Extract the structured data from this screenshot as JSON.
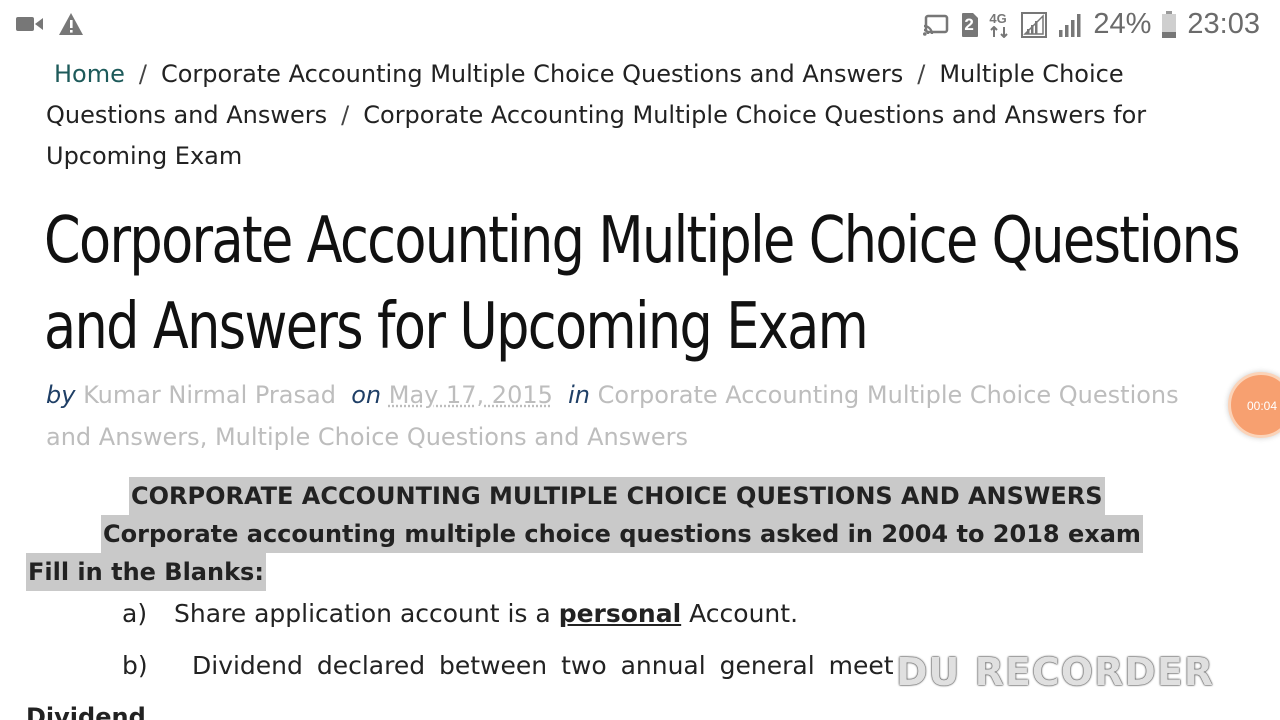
{
  "status_bar": {
    "battery": "24%",
    "time": "23:03",
    "sim_badge": "2",
    "network": "4G",
    "icons": [
      "video-camera-icon",
      "warning-icon",
      "cast-icon",
      "sim-icon",
      "4g-icon",
      "signal-icon",
      "battery-icon"
    ]
  },
  "breadcrumb": {
    "items": [
      "Home",
      "Corporate Accounting Multiple Choice Questions and Answers",
      "Multiple Choice Questions and Answers",
      "Corporate Accounting Multiple Choice Questions and Answers for Upcoming Exam"
    ],
    "separator": "/"
  },
  "article": {
    "title_line1": "Corporate Accounting Multiple Choice Questions",
    "title_line2": "and Answers for Upcoming Exam",
    "meta": {
      "by_label": "by",
      "author": "Kumar Nirmal Prasad",
      "on_label": "on",
      "date": "May 17, 2015",
      "in_label": "in",
      "categories": [
        "Corporate Accounting Multiple Choice Questions and Answers",
        "Multiple Choice Questions and Answers"
      ]
    },
    "heading_1": "CORPORATE ACCOUNTING MULTIPLE CHOICE QUESTIONS AND ANSWERS",
    "heading_2": "Corporate accounting multiple choice questions asked in 2004 to 2018 exam",
    "section_label": "Fill in the Blanks:",
    "questions": [
      {
        "marker": "a)",
        "before": "Share application account is a",
        "answer": "personal",
        "after": "Account."
      },
      {
        "marker": "b)",
        "text": "Dividend declared between two annual general meet"
      }
    ],
    "cut_text": "Dividend"
  },
  "overlay": {
    "bubble_time": "00:04",
    "watermark": "DU RECORDER",
    "colors": {
      "bubble": "#f7a070",
      "highlight": "#c9c9c9",
      "home_link": "#1d5a5a",
      "meta_keyword": "#1f3f66"
    }
  }
}
